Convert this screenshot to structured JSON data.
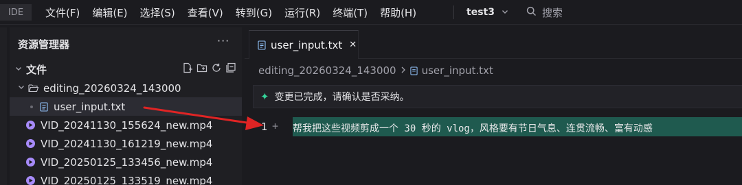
{
  "app": {
    "logo": "IDE"
  },
  "menu": [
    "文件(F)",
    "编辑(E)",
    "选择(S)",
    "查看(V)",
    "转到(G)",
    "运行(R)",
    "终端(T)",
    "帮助(H)"
  ],
  "project": {
    "name": "test3"
  },
  "search": {
    "label": "搜索"
  },
  "sidebar": {
    "title": "资源管理器",
    "more": "···",
    "section": "文件",
    "folder": "editing_20260324_143000",
    "selected_file": "user_input.txt",
    "files": [
      "VID_20241130_155624_new.mp4",
      "VID_20241130_161219_new.mp4",
      "VID_20250125_133456_new.mp4",
      "VID_20250125_133519_new.mp4"
    ]
  },
  "editor": {
    "tab_label": "user_input.txt",
    "breadcrumb": [
      "editing_20260324_143000",
      "user_input.txt"
    ],
    "notice": "变更已完成，请确认是否采纳。",
    "line_number": "1",
    "diff_marker": "+",
    "line_text": "帮我把这些视频剪成一个 30 秒的 vlog，风格要有节日气息、连贯流畅、富有动感"
  },
  "colors": {
    "accent_green": "#34d399",
    "diff_added": "#1f5a4f",
    "annotation_arrow": "#e02424",
    "video_icon": "#a78bfa"
  }
}
